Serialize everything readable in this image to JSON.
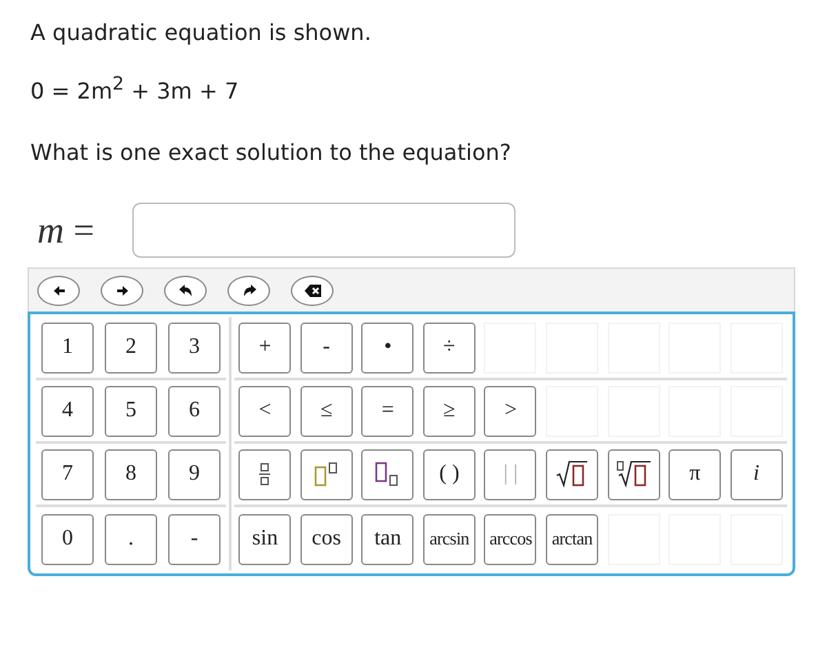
{
  "prompt": "A quadratic equation is shown.",
  "equation": "0 = 2m$^{2}$ + 3m + 7",
  "question": "What is one exact solution to the equation?",
  "answer": {
    "label": "*m* ="
  },
  "toolbar": [
    {
      "kind": "left"
    },
    {
      "kind": "right"
    },
    {
      "kind": "undo"
    },
    {
      "kind": "redo"
    },
    {
      "kind": "backspace"
    }
  ],
  "keypad": {
    "digits": [
      [
        "1",
        "2",
        "3"
      ],
      [
        "4",
        "5",
        "6"
      ],
      [
        "7",
        "8",
        "9"
      ],
      [
        "0",
        ".",
        "-"
      ]
    ],
    "operators": [
      [
        {
          "kind": "text",
          "label": "+"
        },
        {
          "kind": "text",
          "label": "-"
        },
        {
          "kind": "text",
          "label": "•"
        },
        {
          "kind": "text",
          "label": "÷"
        },
        {
          "kind": "blank"
        },
        {
          "kind": "blank"
        },
        {
          "kind": "blank"
        },
        {
          "kind": "blank"
        },
        {
          "kind": "blank"
        }
      ],
      [
        {
          "kind": "text",
          "label": "<"
        },
        {
          "kind": "text",
          "label": "≤"
        },
        {
          "kind": "text",
          "label": "="
        },
        {
          "kind": "text",
          "label": "≥"
        },
        {
          "kind": "text",
          "label": ">"
        },
        {
          "kind": "blank"
        },
        {
          "kind": "blank"
        },
        {
          "kind": "blank"
        },
        {
          "kind": "blank"
        }
      ],
      [
        {
          "kind": "fraction"
        },
        {
          "kind": "power"
        },
        {
          "kind": "subscript"
        },
        {
          "kind": "text",
          "label": "( )"
        },
        {
          "kind": "faint",
          "label": "| |"
        },
        {
          "kind": "sqrt"
        },
        {
          "kind": "nthroot"
        },
        {
          "kind": "text",
          "label": "π"
        },
        {
          "kind": "italic",
          "label": "i"
        }
      ],
      [
        {
          "kind": "text",
          "label": "sin"
        },
        {
          "kind": "text",
          "label": "cos"
        },
        {
          "kind": "text",
          "label": "tan"
        },
        {
          "kind": "small",
          "label": "arcsin"
        },
        {
          "kind": "small",
          "label": "arccos"
        },
        {
          "kind": "small",
          "label": "arctan"
        },
        {
          "kind": "blank"
        },
        {
          "kind": "blank"
        },
        {
          "kind": "blank"
        }
      ]
    ]
  }
}
